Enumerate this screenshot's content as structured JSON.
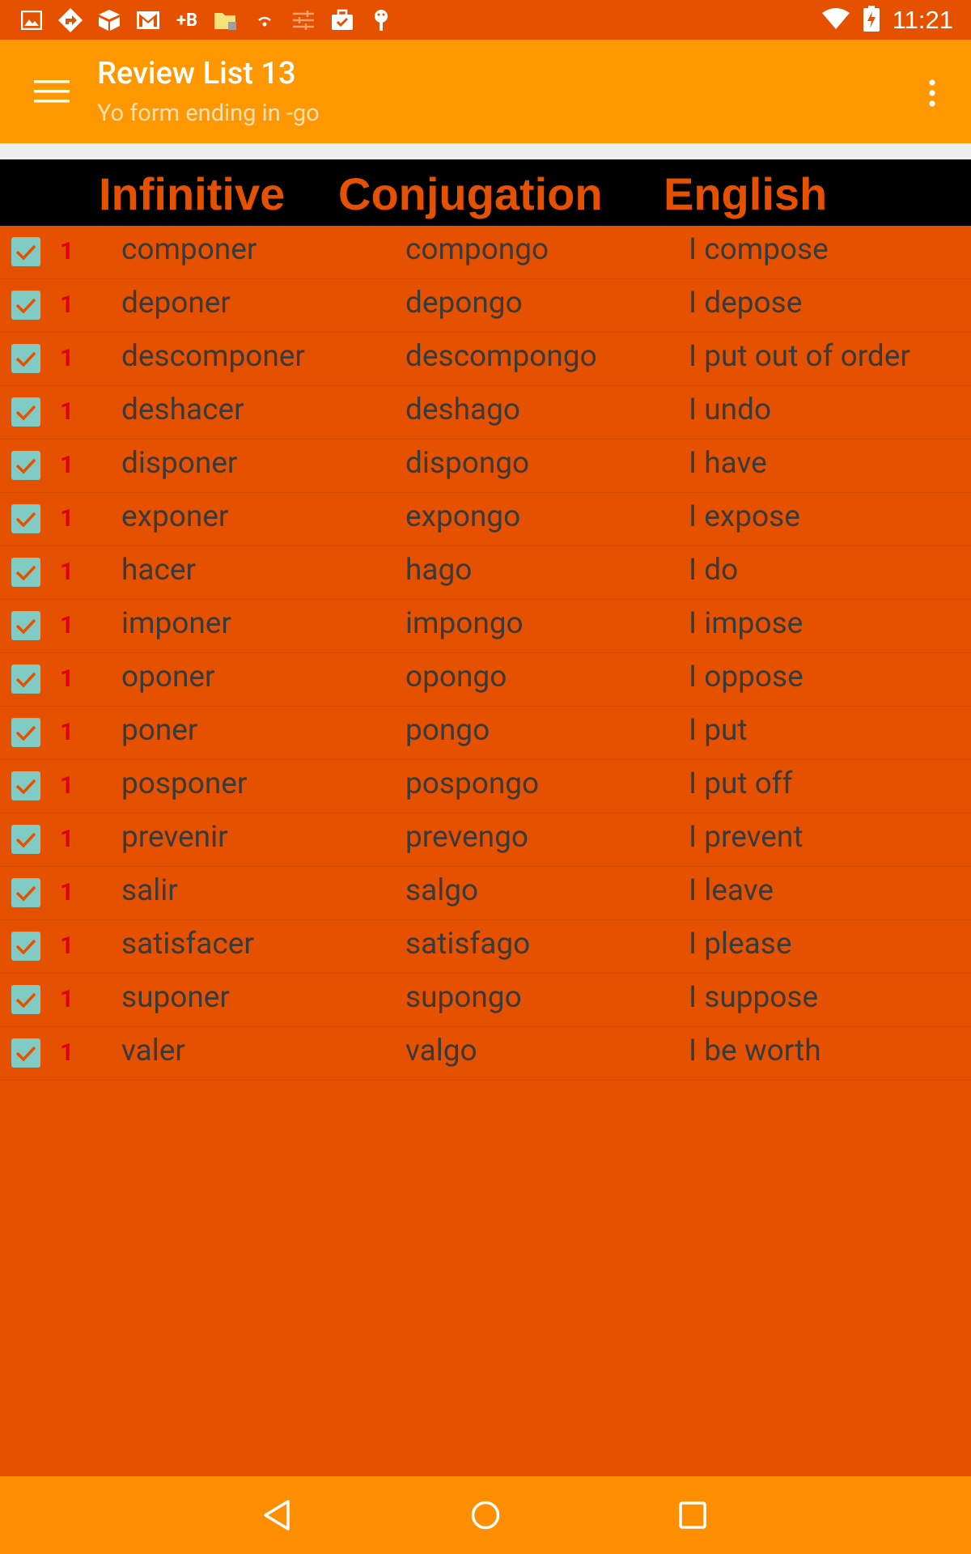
{
  "status_bar": {
    "time": "11:21",
    "left_icons": [
      "image-icon",
      "navigation-icon",
      "box-icon",
      "gmail-icon",
      "plus-b-icon",
      "folder-icon",
      "wifi-small-icon",
      "sliders-icon",
      "briefcase-check-icon",
      "android-icon"
    ],
    "plus_b_label": "+B",
    "right_icons": [
      "wifi-icon",
      "battery-charging-icon"
    ]
  },
  "app_bar": {
    "title": "Review List 13",
    "subtitle": "Yo form ending in -go",
    "menu_icon": "hamburger-menu-icon",
    "overflow_icon": "more-vert-icon"
  },
  "table": {
    "headers": {
      "infinitive": "Infinitive",
      "conjugation": "Conjugation",
      "english": "English"
    },
    "rows": [
      {
        "checked": true,
        "count": "1",
        "infinitive": "componer",
        "conjugation": "compongo",
        "english": "I compose"
      },
      {
        "checked": true,
        "count": "1",
        "infinitive": "deponer",
        "conjugation": "depongo",
        "english": "I depose"
      },
      {
        "checked": true,
        "count": "1",
        "infinitive": "descomponer",
        "conjugation": "descompongo",
        "english": "I put out of order"
      },
      {
        "checked": true,
        "count": "1",
        "infinitive": "deshacer",
        "conjugation": "deshago",
        "english": "I undo"
      },
      {
        "checked": true,
        "count": "1",
        "infinitive": "disponer",
        "conjugation": "dispongo",
        "english": "I have"
      },
      {
        "checked": true,
        "count": "1",
        "infinitive": "exponer",
        "conjugation": "expongo",
        "english": "I expose"
      },
      {
        "checked": true,
        "count": "1",
        "infinitive": "hacer",
        "conjugation": "hago",
        "english": "I do"
      },
      {
        "checked": true,
        "count": "1",
        "infinitive": "imponer",
        "conjugation": "impongo",
        "english": "I impose"
      },
      {
        "checked": true,
        "count": "1",
        "infinitive": "oponer",
        "conjugation": "opongo",
        "english": "I oppose"
      },
      {
        "checked": true,
        "count": "1",
        "infinitive": "poner",
        "conjugation": "pongo",
        "english": "I put"
      },
      {
        "checked": true,
        "count": "1",
        "infinitive": "posponer",
        "conjugation": "pospongo",
        "english": "I put off"
      },
      {
        "checked": true,
        "count": "1",
        "infinitive": "prevenir",
        "conjugation": "prevengo",
        "english": "I prevent"
      },
      {
        "checked": true,
        "count": "1",
        "infinitive": "salir",
        "conjugation": "salgo",
        "english": "I leave"
      },
      {
        "checked": true,
        "count": "1",
        "infinitive": "satisfacer",
        "conjugation": "satisfago",
        "english": "I please"
      },
      {
        "checked": true,
        "count": "1",
        "infinitive": "suponer",
        "conjugation": "supongo",
        "english": "I suppose"
      },
      {
        "checked": true,
        "count": "1",
        "infinitive": "valer",
        "conjugation": "valgo",
        "english": "I be worth"
      }
    ]
  },
  "nav_bar": {
    "icons": [
      "back-icon",
      "home-icon",
      "recents-icon"
    ]
  },
  "colors": {
    "background": "#E65100",
    "app_bar": "#FF9800",
    "header_bg": "#000000",
    "header_text": "#E65100",
    "checkbox": "#80CBC4",
    "count_text": "#E0001A",
    "nav_bar": "#FF8F00"
  }
}
